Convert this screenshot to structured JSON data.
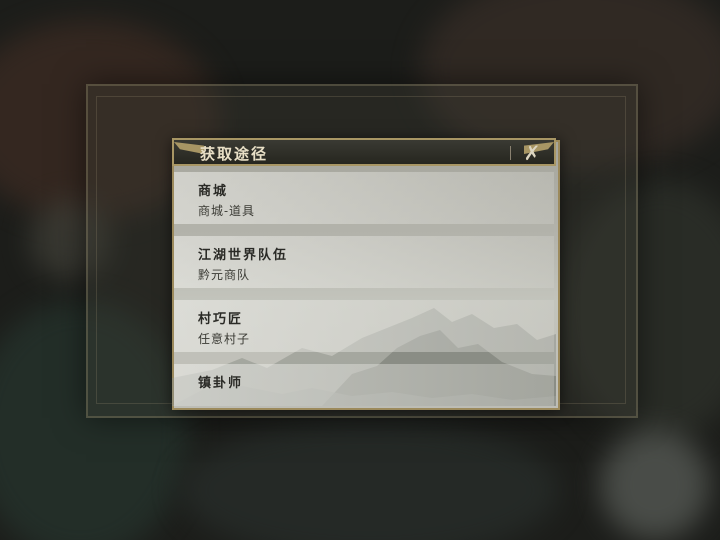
{
  "dialog": {
    "title": "获取途径",
    "close_icon": "close-x-icon"
  },
  "sources": [
    {
      "name": "商城",
      "detail": "商城-道具"
    },
    {
      "name": "江湖世界队伍",
      "detail": "黔元商队"
    },
    {
      "name": "村巧匠",
      "detail": "任意村子"
    },
    {
      "name": "镇卦师",
      "detail": ""
    }
  ],
  "colors": {
    "frame_gold": "#a89664",
    "title_bg": "#2a2a24",
    "panel_bg": "#b8b8b0"
  }
}
